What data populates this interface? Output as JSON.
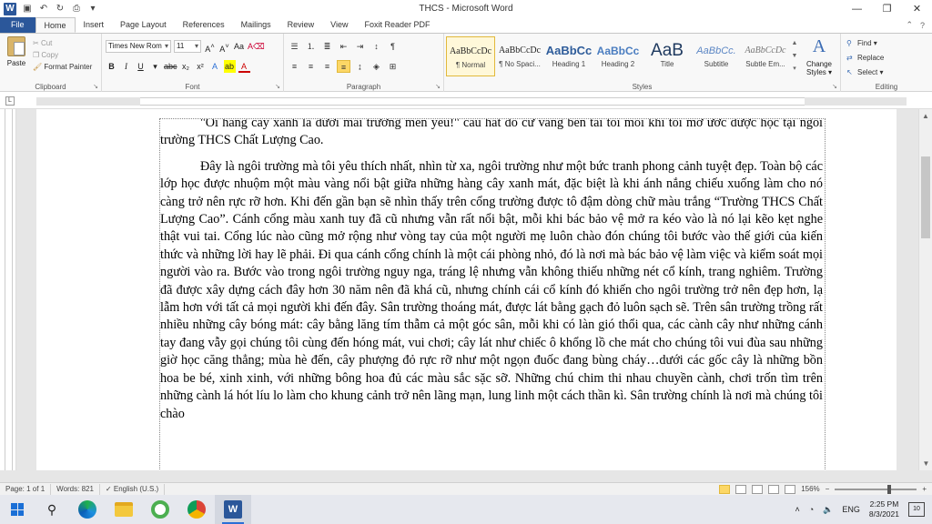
{
  "window": {
    "title": "THCS - Microsoft Word",
    "controls": [
      "—",
      "❐",
      "✕"
    ]
  },
  "tabs": [
    {
      "label": "File"
    },
    {
      "label": "Home"
    },
    {
      "label": "Insert"
    },
    {
      "label": "Page Layout"
    },
    {
      "label": "References"
    },
    {
      "label": "Mailings"
    },
    {
      "label": "Review"
    },
    {
      "label": "View"
    },
    {
      "label": "Foxit Reader PDF"
    }
  ],
  "ribbon": {
    "clipboard": {
      "label": "Clipboard",
      "paste": "Paste",
      "cut": "Cut",
      "copy": "Copy",
      "format_painter": "Format Painter"
    },
    "font": {
      "label": "Font",
      "name": "Times New Rom",
      "size": "11"
    },
    "paragraph": {
      "label": "Paragraph"
    },
    "styles": {
      "label": "Styles",
      "items": [
        {
          "sample": "AaBbCcDc",
          "name": "¶ Normal"
        },
        {
          "sample": "AaBbCcDc",
          "name": "¶ No Spaci..."
        },
        {
          "sample": "AaBbCc",
          "name": "Heading 1"
        },
        {
          "sample": "AaBbCc",
          "name": "Heading 2"
        },
        {
          "sample": "AaB",
          "name": "Title"
        },
        {
          "sample": "AaBbCc.",
          "name": "Subtitle"
        },
        {
          "sample": "AaBbCcDc",
          "name": "Subtle Em..."
        }
      ],
      "change_styles_1": "Change",
      "change_styles_2": "Styles ▾"
    },
    "editing": {
      "label": "Editing",
      "find": "Find ▾",
      "replace": "Replace",
      "select": "Select ▾"
    }
  },
  "document": {
    "paragraphs": [
      "\"Ôi hàng cây xanh lá dưới mái trường mến yêu!\" câu hát đó cứ vang bên tai tôi mỗi khi tôi mơ ước được học tại ngôi trường THCS Chất Lượng Cao.",
      "Đây là ngôi trường mà tôi yêu thích nhất, nhìn từ xa, ngôi trường như một bức tranh phong cảnh tuyệt đẹp. Toàn bộ các lớp học được nhuộm một màu vàng nổi bật giữa những hàng cây xanh mát, đặc biệt là khi ánh nắng chiếu xuống làm cho nó càng trở nên rực rỡ hơn. Khi đến gần bạn sẽ nhìn thấy trên cổng trường được tô đậm dòng chữ màu trắng “Trường THCS Chất Lượng Cao”. Cánh cổng màu xanh tuy đã cũ nhưng vẫn rất nổi bật, mỗi khi bác bảo vệ mở ra kéo vào là nó lại kẽo kẹt nghe thật vui tai. Cổng lúc nào cũng mở rộng như vòng tay của một người mẹ luôn chào đón chúng tôi bước vào thế giới của kiến thức và những lời hay lẽ phải. Đi qua cánh cổng chính là một cái phòng nhỏ, đó là nơi mà bác bảo vệ làm việc và kiểm soát mọi người vào ra. Bước vào trong ngôi trường nguy nga, tráng lệ nhưng vẫn không thiếu những nét cổ kính, trang nghiêm. Trường đã được xây dựng cách đây hơn 30 năm nên đã khá cũ, nhưng chính cái cổ kính đó khiến cho ngôi trường trở nên đẹp hơn, lạ lẫm hơn với tất cả mọi người khi đến đây. Sân trường thoáng mát, được lát bằng gạch đỏ luôn sạch sẽ. Trên sân trường trồng rất nhiều những cây bóng mát: cây bằng lăng tím thẫm cả một góc sân, mỗi khi có làn gió thổi qua, các cành cây như những cánh tay đang vẫy gọi chúng tôi cùng đến hóng mát, vui chơi; cây lát như chiếc ô khổng lồ che mát cho chúng tôi vui đùa sau những giờ học căng thẳng; mùa hè đến, cây phượng đỏ rực rỡ như một ngọn đuốc đang bùng cháy…dưới các gốc cây là những bồn hoa be bé, xinh xinh, với những bông hoa đủ các màu sắc sặc sỡ. Những chú chim thi nhau chuyền cành, chơi trốn tìm trên những cành lá hót líu lo làm cho khung cảnh trở nên lãng mạn, lung linh một cách thần kì. Sân trường chính là nơi mà chúng tôi chào"
    ]
  },
  "status": {
    "page": "Page: 1 of 1",
    "words": "Words: 821",
    "language": "English (U.S.)",
    "zoom": "156%"
  },
  "taskbar": {
    "lang": "ENG",
    "time": "2:25 PM",
    "date": "8/3/2021",
    "notif_count": "10"
  }
}
